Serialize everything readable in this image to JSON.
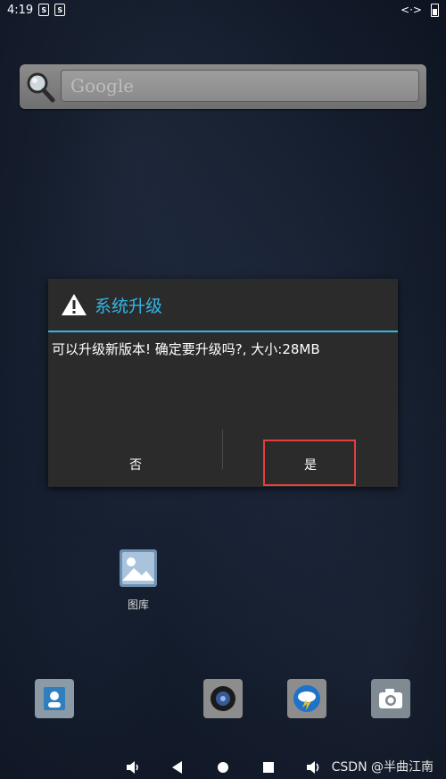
{
  "status_bar": {
    "time": "4:19",
    "left_badges": [
      "S",
      "S"
    ],
    "right_glyph": "<·>"
  },
  "search": {
    "placeholder": "Google"
  },
  "dialog": {
    "title": "系统升级",
    "message": "可以升级新版本! 确定要升级吗?, 大小:28MB",
    "negative_label": "否",
    "positive_label": "是"
  },
  "apps": {
    "gallery_label": "图库"
  },
  "watermark": "CSDN @半曲江南",
  "colors": {
    "accent": "#33b5e5",
    "highlight": "#e04040"
  }
}
